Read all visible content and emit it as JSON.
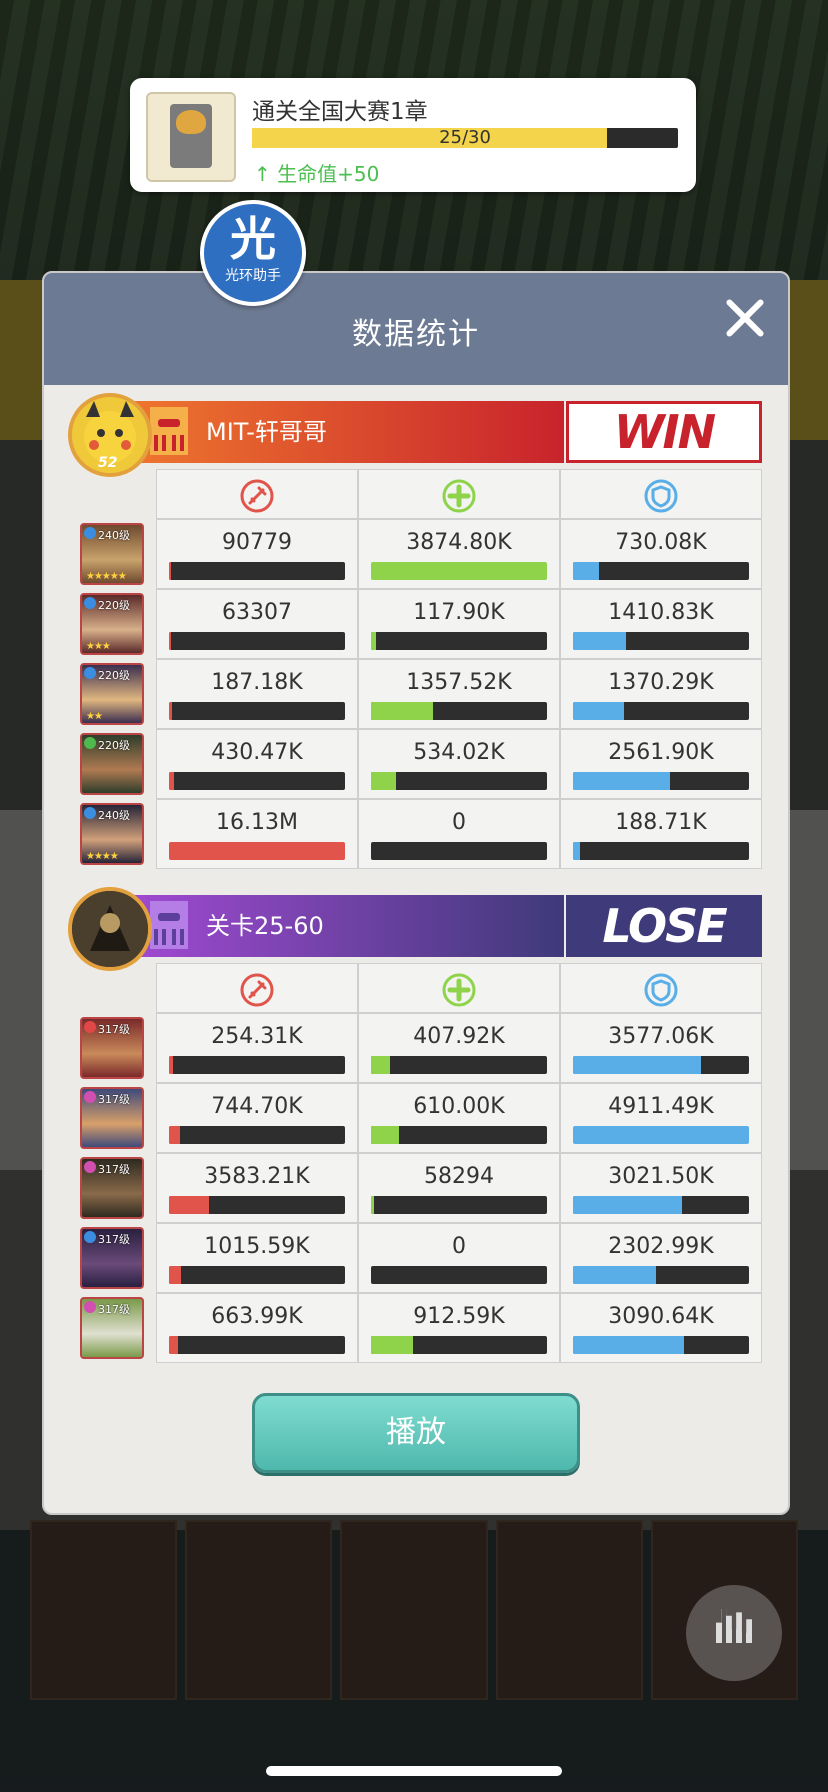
{
  "quest": {
    "title": "通关全国大赛1章",
    "progress_text": "25/30",
    "progress": 0.833,
    "reward": "生命值+50"
  },
  "halo_badge": {
    "glyph": "光",
    "label": "光环助手"
  },
  "panel": {
    "title": "数据统计",
    "play_label": "播放"
  },
  "stat_icons": [
    "damage-icon",
    "heal-icon",
    "shield-icon"
  ],
  "colors": {
    "damage": "#e0544b",
    "heal": "#8fd34b",
    "shield": "#5aaee8",
    "win": "#c8232c",
    "lose": "#3f3a7a"
  },
  "teams": [
    {
      "name": "MIT-轩哥哥",
      "result": "WIN",
      "avatar_level": "52",
      "heroes": [
        {
          "level": "240级",
          "damage": "90779",
          "heal": "3874.80K",
          "shield": "730.08K",
          "damage_pct": 0.01,
          "heal_pct": 1.0,
          "shield_pct": 0.15,
          "stars": "★★★★★",
          "gem": "#3b8de0"
        },
        {
          "level": "220级",
          "damage": "63307",
          "heal": "117.90K",
          "shield": "1410.83K",
          "damage_pct": 0.005,
          "heal_pct": 0.03,
          "shield_pct": 0.3,
          "stars": "★★★",
          "gem": "#3b8de0"
        },
        {
          "level": "220级",
          "damage": "187.18K",
          "heal": "1357.52K",
          "shield": "1370.29K",
          "damage_pct": 0.015,
          "heal_pct": 0.35,
          "shield_pct": 0.29,
          "stars": "★★",
          "gem": "#3b8de0"
        },
        {
          "level": "220级",
          "damage": "430.47K",
          "heal": "534.02K",
          "shield": "2561.90K",
          "damage_pct": 0.03,
          "heal_pct": 0.14,
          "shield_pct": 0.55,
          "stars": "",
          "gem": "#4fb84f"
        },
        {
          "level": "240级",
          "damage": "16.13M",
          "heal": "0",
          "shield": "188.71K",
          "damage_pct": 1.0,
          "heal_pct": 0.0,
          "shield_pct": 0.04,
          "stars": "★★★★",
          "gem": "#3b8de0"
        }
      ]
    },
    {
      "name": "关卡25-60",
      "result": "LOSE",
      "heroes": [
        {
          "level": "317级",
          "damage": "254.31K",
          "heal": "407.92K",
          "shield": "3577.06K",
          "damage_pct": 0.02,
          "heal_pct": 0.11,
          "shield_pct": 0.73,
          "stars": "",
          "gem": "#e04848"
        },
        {
          "level": "317级",
          "damage": "744.70K",
          "heal": "610.00K",
          "shield": "4911.49K",
          "damage_pct": 0.06,
          "heal_pct": 0.16,
          "shield_pct": 1.0,
          "stars": "",
          "gem": "#d04fb0"
        },
        {
          "level": "317级",
          "damage": "3583.21K",
          "heal": "58294",
          "shield": "3021.50K",
          "damage_pct": 0.23,
          "heal_pct": 0.015,
          "shield_pct": 0.62,
          "stars": "",
          "gem": "#d04fb0"
        },
        {
          "level": "317级",
          "damage": "1015.59K",
          "heal": "0",
          "shield": "2302.99K",
          "damage_pct": 0.07,
          "heal_pct": 0.0,
          "shield_pct": 0.47,
          "stars": "",
          "gem": "#3b8de0"
        },
        {
          "level": "317级",
          "damage": "663.99K",
          "heal": "912.59K",
          "shield": "3090.64K",
          "damage_pct": 0.05,
          "heal_pct": 0.24,
          "shield_pct": 0.63,
          "stars": "",
          "gem": "#d04fb0"
        }
      ]
    }
  ]
}
